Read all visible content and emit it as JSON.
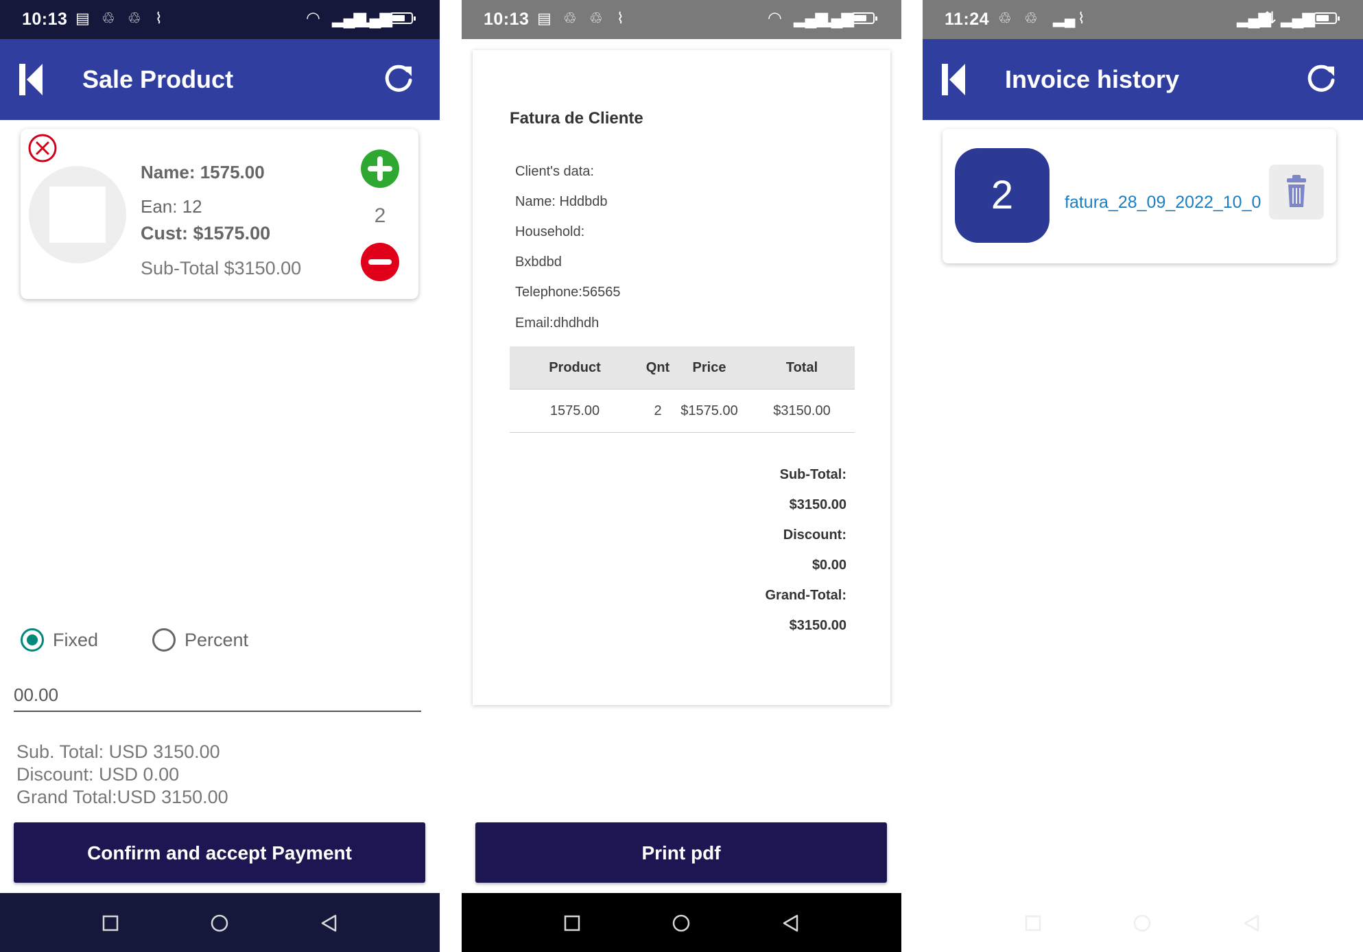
{
  "colors": {
    "appbar": "#303f9f",
    "status_dark": "#15183a",
    "status_gray": "#7a7a7a",
    "nav_dark": "#15183a",
    "nav_black": "#000000",
    "button": "#1c1752",
    "plus": "#2fa832",
    "minus": "#e0001a",
    "radio": "#00897b",
    "badge": "#2c3a96",
    "link": "#1a7ec4"
  },
  "sale": {
    "status_time": "10:13",
    "title": "Sale Product",
    "item": {
      "name": "Name: 1575.00",
      "ean": "Ean: 12",
      "cust": "Cust: $1575.00",
      "subtotal": "Sub-Total $3150.00",
      "qty": "2"
    },
    "radio_fixed": "Fixed",
    "radio_percent": "Percent",
    "discount_value": "00.00",
    "totals": {
      "sub": "Sub. Total: USD 3150.00",
      "discount": "Discount: USD 0.00",
      "grand": "Grand Total:USD 3150.00"
    },
    "confirm_button": "Confirm and accept Payment"
  },
  "invoice": {
    "status_time": "10:13",
    "title": "Fatura de Cliente",
    "client": [
      "Client's data:",
      "Name: Hddbdb",
      "Household:",
      "Bxbdbd",
      "Telephone:56565",
      "Email:dhdhdh"
    ],
    "table": {
      "headers": [
        "Product",
        "Qnt",
        "Price",
        "Total"
      ],
      "rows": [
        [
          "1575.00",
          "2",
          "$1575.00",
          "$3150.00"
        ]
      ]
    },
    "summary": [
      "Sub-Total:",
      "$3150.00",
      "Discount:",
      "$0.00",
      "Grand-Total:",
      "$3150.00"
    ],
    "print_button": "Print pdf"
  },
  "history": {
    "status_time": "11:24",
    "title": "Invoice history",
    "items": [
      {
        "badge": "2",
        "filename": "fatura_28_09_2022_10_0"
      }
    ]
  },
  "icons": [
    "back-logo-icon",
    "refresh-icon",
    "close-circle-icon",
    "plus-circle-icon",
    "minus-circle-icon",
    "trash-icon",
    "nav-square-icon",
    "nav-circle-icon",
    "nav-back-icon",
    "wifi-icon",
    "signal-icon",
    "battery-icon"
  ]
}
